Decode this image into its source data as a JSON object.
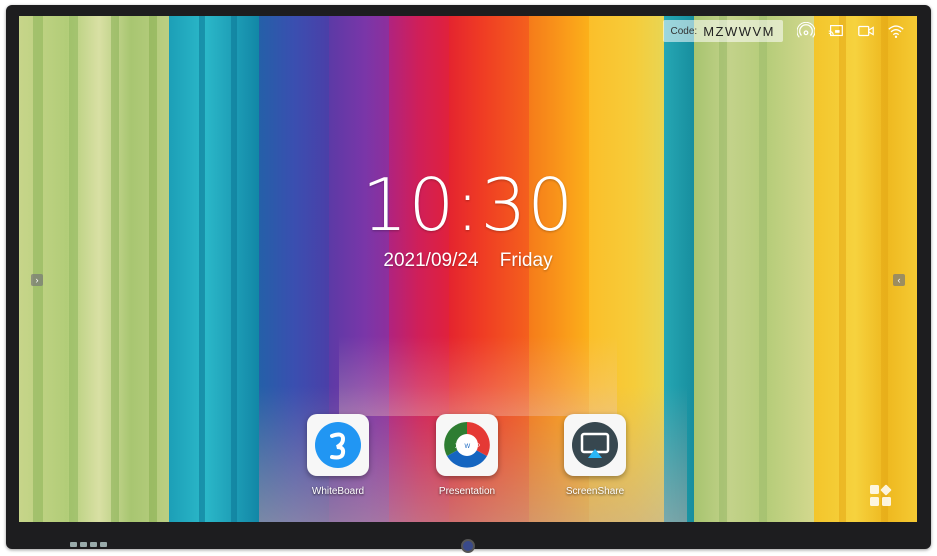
{
  "header": {
    "code_label": "Code:",
    "code_value": "MZWWVM",
    "status_icons": [
      "hotspot-icon",
      "screen-mirror-icon",
      "camera-icon",
      "wifi-icon"
    ]
  },
  "clock": {
    "time": "10:30",
    "date": "2021/09/24",
    "weekday": "Friday"
  },
  "nav": {
    "left_arrow": "›",
    "right_arrow": "‹"
  },
  "apps": [
    {
      "label": "WhiteBoard",
      "icon": "whiteboard-icon"
    },
    {
      "label": "Presentation",
      "icon": "presentation-icon"
    },
    {
      "label": "ScreenShare",
      "icon": "screenshare-icon"
    }
  ],
  "menu": {
    "icon": "app-grid-icon"
  },
  "colors": {
    "bezel": "#1d1d1f",
    "whiteboard_blue": "#2196f3",
    "screenshare_blue": "#1e88e5"
  }
}
